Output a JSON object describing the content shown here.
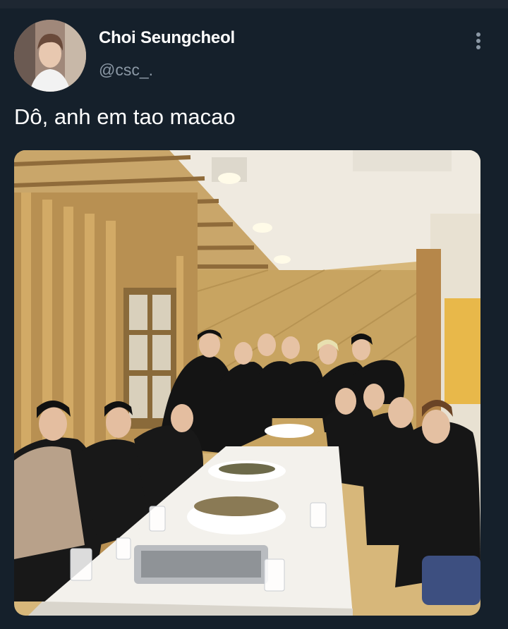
{
  "tweet": {
    "author_name": "Choi Seungcheol",
    "author_handle": "@csc_.",
    "text": "Dô, anh em tao macao"
  },
  "icons": {
    "more": "vertical-ellipsis-icon"
  },
  "colors": {
    "background": "#15202b",
    "secondary_text": "#8b98a5"
  }
}
